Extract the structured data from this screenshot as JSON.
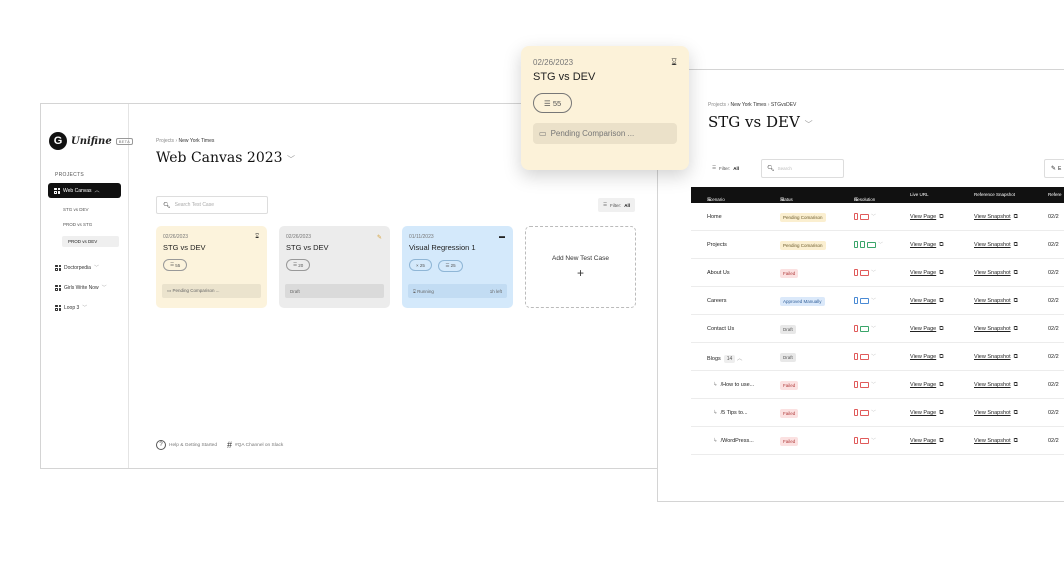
{
  "sidebar": {
    "logo_text": "Unifine",
    "beta": "BETA",
    "section": "PROJECTS",
    "active_project": "Web Canvas",
    "sub_items": [
      "STG vs DEV",
      "PROD vs STG",
      "PROD vs DEV"
    ],
    "projects": [
      "Doctorpedia",
      "Girls Write Now",
      "Loop 3"
    ]
  },
  "left": {
    "breadcrumb_root": "Projects",
    "breadcrumb_current": "New York Times",
    "title": "Web Canvas 2023",
    "search_placeholder": "Search Test Case",
    "filter_label": "Filter:",
    "filter_value": "All",
    "cards": [
      {
        "date": "02/26/2023",
        "name": "STG vs DEV",
        "count": "55",
        "status": "Pending Comparison ...",
        "icon": "hourglass-icon"
      },
      {
        "date": "02/26/2023",
        "name": "STG vs DEV",
        "count": "20",
        "status": "Draft",
        "icon": "pencil-icon"
      },
      {
        "date": "01/11/2023",
        "name": "Visual Regression 1",
        "failed": "25",
        "count": "25",
        "status": "Running",
        "time_left": "1h left",
        "icon": "running-icon"
      }
    ],
    "add_card": "Add New Test Case",
    "footer_help": "Help & Getting Started",
    "footer_slack": "#QA Channel on Slack"
  },
  "popup": {
    "date": "02/26/2023",
    "name": "STG vs DEV",
    "count": "55",
    "status": "Pending Comparison ..."
  },
  "right": {
    "breadcrumb_root": "Projects",
    "breadcrumb_mid": "New York Times",
    "breadcrumb_current": "STGvsDEV",
    "title": "STG vs DEV",
    "filter_label": "Filter:",
    "filter_value": "All",
    "search_placeholder": "Search",
    "edit_label": "E",
    "columns": [
      "Scenario Name",
      "Status",
      "Resolution",
      "Live URL",
      "Reference Snapshot",
      "Refere"
    ],
    "live_link": "View Page",
    "snapshot_link": "View Snapshot",
    "date_prefix": "02/2",
    "rows": [
      {
        "name": "Home",
        "status": "Pending Comarison",
        "status_type": "pending"
      },
      {
        "name": "Projects",
        "status": "Pending Comarison",
        "status_type": "pending"
      },
      {
        "name": "About Us",
        "status": "Failed",
        "status_type": "failed"
      },
      {
        "name": "Careers",
        "status": "Approved Manually",
        "status_type": "approved"
      },
      {
        "name": "Contact Us",
        "status": "Draft",
        "status_type": "draft"
      },
      {
        "name": "Blogs",
        "count": "14",
        "status": "Draft",
        "status_type": "draft"
      },
      {
        "name": "/How to use...",
        "status": "Failed",
        "status_type": "failed",
        "child": true
      },
      {
        "name": "/5 Tips to...",
        "status": "Failed",
        "status_type": "failed",
        "child": true
      },
      {
        "name": "/WordPress...",
        "status": "Failed",
        "status_type": "failed",
        "child": true
      }
    ]
  }
}
